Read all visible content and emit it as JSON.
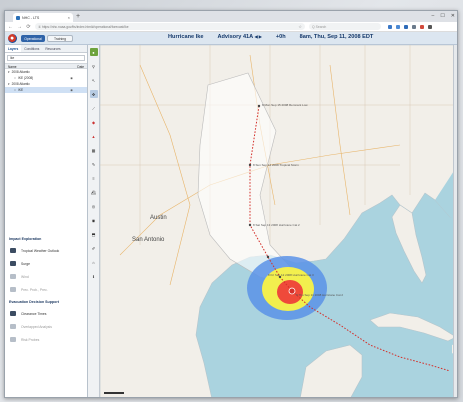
{
  "browser": {
    "tab_title": "NHC - LTS",
    "tab_close": "×",
    "new_tab": "+",
    "window_controls": [
      "–",
      "☐",
      "✕"
    ],
    "url": "① https://nhc.noaa.gov/lts/index.html#/operational/forecast/ike",
    "star": "☆",
    "search_placeholder": "Q  Search"
  },
  "app": {
    "mode_operational": "Operational",
    "mode_training": "Training",
    "storm_name": "Hurricane Ike",
    "advisory": "Advisory 41A",
    "advisory_arrows": "◀ ▶",
    "time_zone": "+0h",
    "issued": "8am, Thu, Sep 11, 2008 EDT"
  },
  "left_panel": {
    "tabs": [
      "Layers",
      "Conditions",
      "Resources"
    ],
    "filter_value": "Ike",
    "column_name": "Name",
    "column_date": "Date",
    "tree": [
      {
        "label": "2008 Atlantic",
        "level": 0,
        "selected": false
      },
      {
        "label": "IKE (2008)",
        "level": 1,
        "selected": false
      },
      {
        "label": "2008 Atlantic",
        "level": 0,
        "selected": false
      },
      {
        "label": "IKE",
        "level": 1,
        "selected": true
      }
    ],
    "impact_title": "Impact Exploration",
    "impact_tools": [
      {
        "label": "Tropical Weather Outlook",
        "enabled": true
      },
      {
        "label": "Surge",
        "enabled": true
      },
      {
        "label": "Wind",
        "enabled": false
      },
      {
        "label": "Prec. Prob., Prec.",
        "enabled": false
      }
    ],
    "evac_title": "Evacuation Decision Support",
    "evac_tools": [
      {
        "label": "Clearance Times",
        "enabled": true
      },
      {
        "label": "Overlapped Analysis",
        "enabled": false
      },
      {
        "label": "Risk Probes",
        "enabled": false
      }
    ]
  },
  "map": {
    "city_labels": [
      "Austin",
      "San Antonio"
    ],
    "track_points": [
      "8 Mon Sep 15 2008 Remnant Low",
      "8 Sun Sep 14 2008 Tropical Storm",
      "8 Sat Sep 13 2008 Hurricane Cat 2",
      "8 Fri Sep 12 2008 Hurricane Cat 3",
      "8 Thu Sep 11 2008 Hurricane Cat 2"
    ],
    "colors": {
      "water": "#aad3df",
      "land": "#f2efe9",
      "cone": "#ffffff",
      "wind_outer": "#5a92e8",
      "wind_mid": "#f2ef4e",
      "wind_inner": "#ef4a3a",
      "track": "#d4302b"
    }
  }
}
